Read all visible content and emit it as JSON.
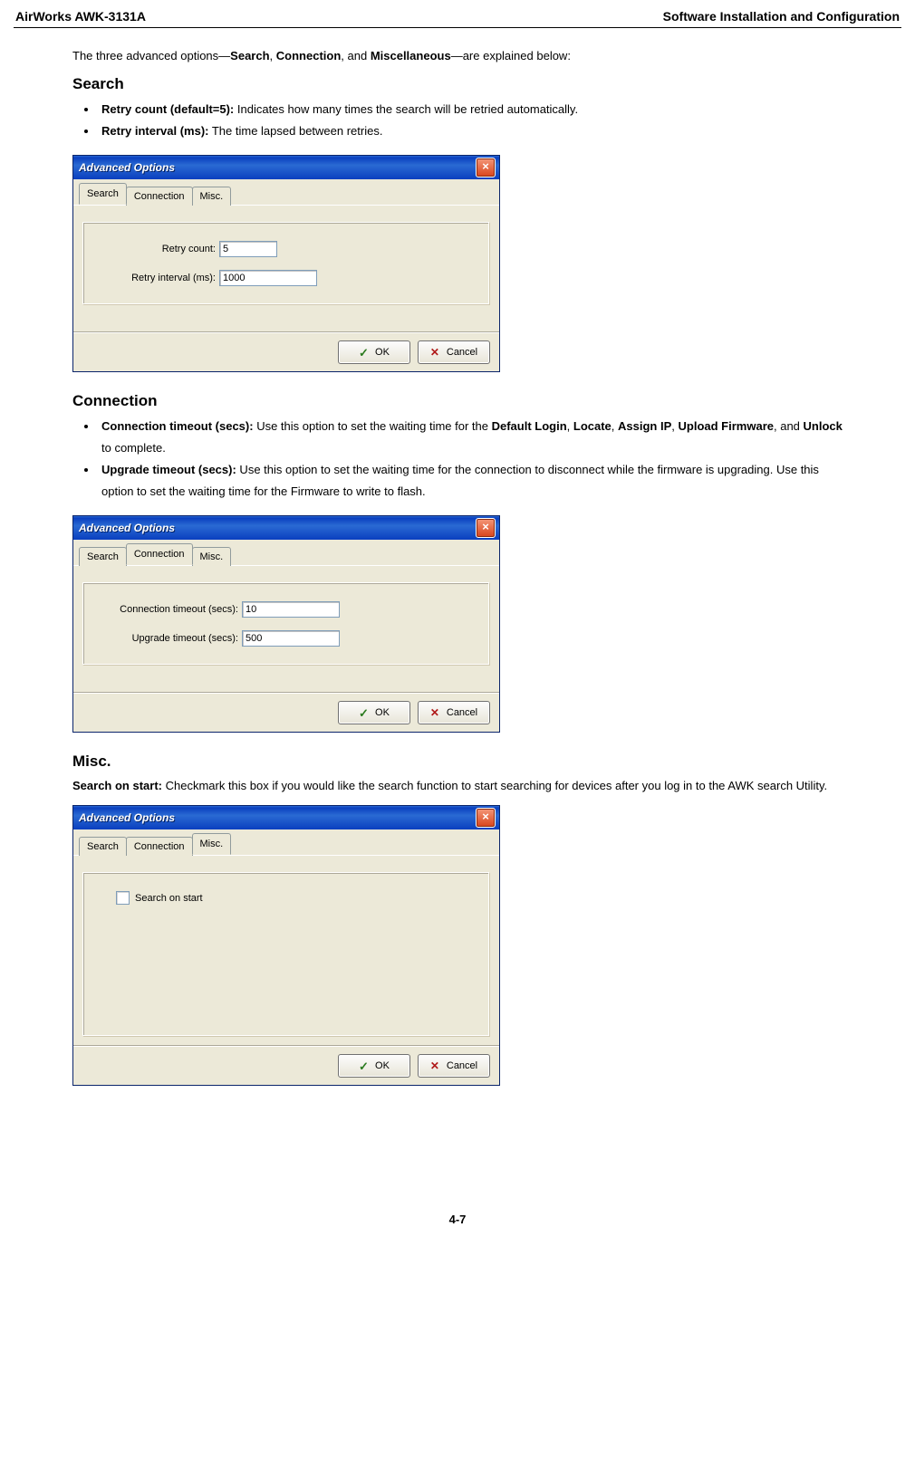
{
  "header": {
    "left": "AirWorks AWK-3131A",
    "right": "Software Installation and Configuration"
  },
  "intro": {
    "prefix": "The three advanced options—",
    "b1": "Search",
    "sep1": ", ",
    "b2": "Connection",
    "sep2": ", and ",
    "b3": "Miscellaneous",
    "suffix": "—are explained below:"
  },
  "search": {
    "heading": "Search",
    "item1_b": "Retry count (default=5):",
    "item1_t": " Indicates how many times the search will be retried automatically.",
    "item2_b": "Retry interval (ms):",
    "item2_t": " The time lapsed between retries."
  },
  "connection": {
    "heading": "Connection",
    "item1_b": "Connection timeout (secs):",
    "item1_t1": " Use this option to set the waiting time for the ",
    "item1_b2": "Default Login",
    "item1_s1": ", ",
    "item1_b3": "Locate",
    "item1_s2": ", ",
    "item1_b4": "Assign IP",
    "item1_s3": ", ",
    "item1_b5": "Upload Firmware",
    "item1_s4": ", and ",
    "item1_b6": "Unlock",
    "item1_t2": " to complete.",
    "item2_b": "Upgrade timeout (secs):",
    "item2_t": " Use this option to set the waiting time for the connection to disconnect while the firmware is upgrading. Use this option to set the waiting time for the Firmware to write to flash."
  },
  "misc": {
    "heading": "Misc.",
    "para_b": "Search on start:",
    "para_t": " Checkmark this box if you would like the search function to start searching for devices after you log in to the AWK search Utility."
  },
  "dialog": {
    "title": "Advanced Options",
    "tab_search": "Search",
    "tab_connection": "Connection",
    "tab_misc": "Misc.",
    "retry_count_label": "Retry count:",
    "retry_count_value": "5",
    "retry_interval_label": "Retry interval (ms):",
    "retry_interval_value": "1000",
    "conn_timeout_label": "Connection timeout (secs):",
    "conn_timeout_value": "10",
    "upgrade_timeout_label": "Upgrade timeout (secs):",
    "upgrade_timeout_value": "500",
    "search_on_start_label": "Search on start",
    "ok": "OK",
    "cancel": "Cancel"
  },
  "footer": "4-7"
}
